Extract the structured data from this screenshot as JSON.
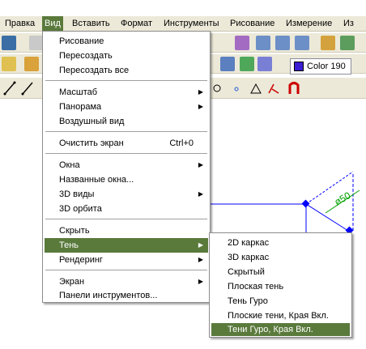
{
  "menubar": {
    "items": [
      "Правка",
      "Вид",
      "Вставить",
      "Формат",
      "Инструменты",
      "Рисование",
      "Измерение",
      "Из"
    ],
    "active_index": 1
  },
  "toolbar": {
    "color_label": "Color 190",
    "color_swatch": "#3b1ed1"
  },
  "view_menu": {
    "items": [
      {
        "label": "Рисование"
      },
      {
        "label": "Пересоздать"
      },
      {
        "label": "Пересоздать все"
      },
      {
        "label": "Масштаб",
        "submenu": true
      },
      {
        "label": "Панорама",
        "submenu": true
      },
      {
        "label": "Воздушный вид"
      },
      {
        "label": "Очистить экран",
        "shortcut": "Ctrl+0"
      },
      {
        "label": "Окна",
        "submenu": true
      },
      {
        "label": "Названные окна..."
      },
      {
        "label": "3D виды",
        "submenu": true
      },
      {
        "label": "3D орбита"
      },
      {
        "label": "Скрыть"
      },
      {
        "label": "Тень",
        "submenu": true,
        "highlighted": true
      },
      {
        "label": "Рендеринг",
        "submenu": true
      },
      {
        "label": "Экран",
        "submenu": true
      },
      {
        "label": "Панели инструментов..."
      }
    ]
  },
  "shade_submenu": {
    "items": [
      {
        "label": "2D каркас"
      },
      {
        "label": "3D каркас"
      },
      {
        "label": "Скрытый"
      },
      {
        "label": "Плоская тень"
      },
      {
        "label": "Тень Гуро"
      },
      {
        "label": "Плоские тени, Края Вкл."
      },
      {
        "label": "Тени Гуро, Края Вкл.",
        "highlighted": true
      }
    ]
  },
  "drawing": {
    "dimension_text": "ø50",
    "line_color": "#0000ff",
    "dim_color": "#00a000"
  },
  "colors": {
    "menu_highlight": "#5a7a3c",
    "chrome": "#ece9d8"
  }
}
